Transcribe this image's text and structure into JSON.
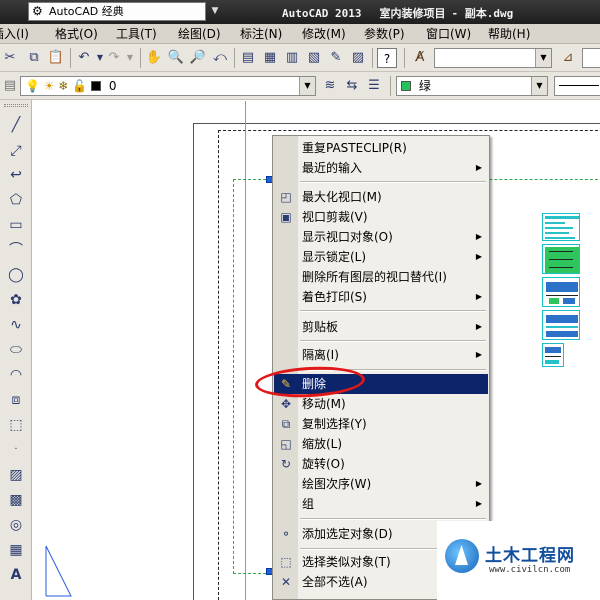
{
  "titlebar": {
    "workspace": "AutoCAD 经典",
    "app_title": "AutoCAD 2013",
    "project": "室内装修项目",
    "file": "- 副本.dwg"
  },
  "menubar": [
    "插入(I)",
    "格式(O)",
    "工具(T)",
    "绘图(D)",
    "标注(N)",
    "修改(M)",
    "参数(P)",
    "窗口(W)",
    "帮助(H)"
  ],
  "layer_toolbar": {
    "layer_value": "0",
    "color_value": "绿",
    "color_hex": "#22c45a"
  },
  "context_menu": {
    "items": [
      {
        "label": "重复PASTECLIP(R)",
        "icon": "",
        "submenu": false
      },
      {
        "label": "最近的输入",
        "icon": "",
        "submenu": true
      },
      {
        "label": "最大化视口(M)",
        "icon": "maximize-viewport-icon",
        "submenu": false
      },
      {
        "label": "视口剪裁(V)",
        "icon": "viewport-clip-icon",
        "submenu": false
      },
      {
        "label": "显示视口对象(O)",
        "icon": "",
        "submenu": true
      },
      {
        "label": "显示锁定(L)",
        "icon": "",
        "submenu": true
      },
      {
        "label": "删除所有图层的视口替代(I)",
        "icon": "",
        "submenu": false
      },
      {
        "label": "着色打印(S)",
        "icon": "",
        "submenu": true
      },
      {
        "label": "剪贴板",
        "icon": "",
        "submenu": true
      },
      {
        "label": "隔离(I)",
        "icon": "",
        "submenu": true
      },
      {
        "label": "删除",
        "icon": "eraser-icon",
        "submenu": false
      },
      {
        "label": "移动(M)",
        "icon": "move-icon",
        "submenu": false
      },
      {
        "label": "复制选择(Y)",
        "icon": "copy-icon",
        "submenu": false
      },
      {
        "label": "缩放(L)",
        "icon": "scale-icon",
        "submenu": false
      },
      {
        "label": "旋转(O)",
        "icon": "rotate-icon",
        "submenu": false
      },
      {
        "label": "绘图次序(W)",
        "icon": "",
        "submenu": true
      },
      {
        "label": "组",
        "icon": "",
        "submenu": true
      },
      {
        "label": "添加选定对象(D)",
        "icon": "add-selected-icon",
        "submenu": false
      },
      {
        "label": "选择类似对象(T)",
        "icon": "select-similar-icon",
        "submenu": false
      },
      {
        "label": "全部不选(A)",
        "icon": "deselect-all-icon",
        "submenu": false
      }
    ],
    "highlighted": "删除",
    "highlight_color": "#0b246a"
  },
  "watermark": {
    "title": "土木工程网",
    "url": "www.civilcn.com"
  }
}
